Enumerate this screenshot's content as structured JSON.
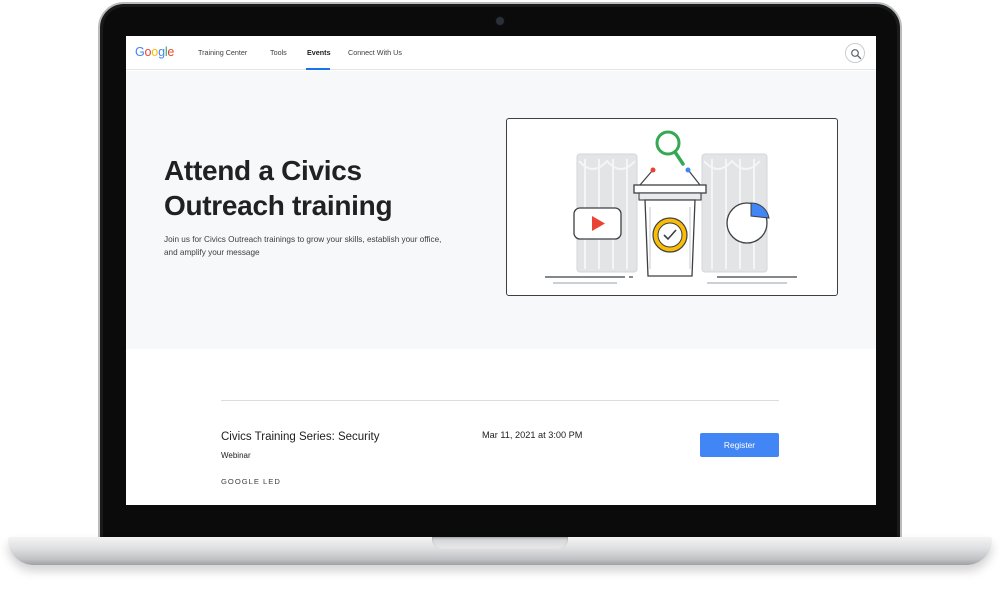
{
  "colors": {
    "accent": "#1a73e8",
    "button": "#4285f4",
    "hero_bg": "#f7f8f9",
    "logo": [
      "#4285F4",
      "#EA4335",
      "#FBBC05",
      "#4285F4",
      "#34A853",
      "#EA4335"
    ]
  },
  "nav": {
    "logo_text": "Google",
    "items": [
      {
        "label": "Training Center"
      },
      {
        "label": "Tools"
      },
      {
        "label": "Events",
        "active": true
      },
      {
        "label": "Connect With Us"
      }
    ],
    "search_icon": "search-icon"
  },
  "hero": {
    "title_line1": "Attend a Civics",
    "title_line2": "Outreach training",
    "subtitle": "Join us for Civics Outreach trainings to grow your skills, establish your office, and amplify your message",
    "illustration": "podium-with-magnifier-video-pie-chart"
  },
  "event": {
    "title": "Civics Training Series: Security",
    "type": "Webinar",
    "date": "Mar 11, 2021 at 3:00 PM",
    "organizer": "GOOGLE LED",
    "register_label": "Register"
  }
}
